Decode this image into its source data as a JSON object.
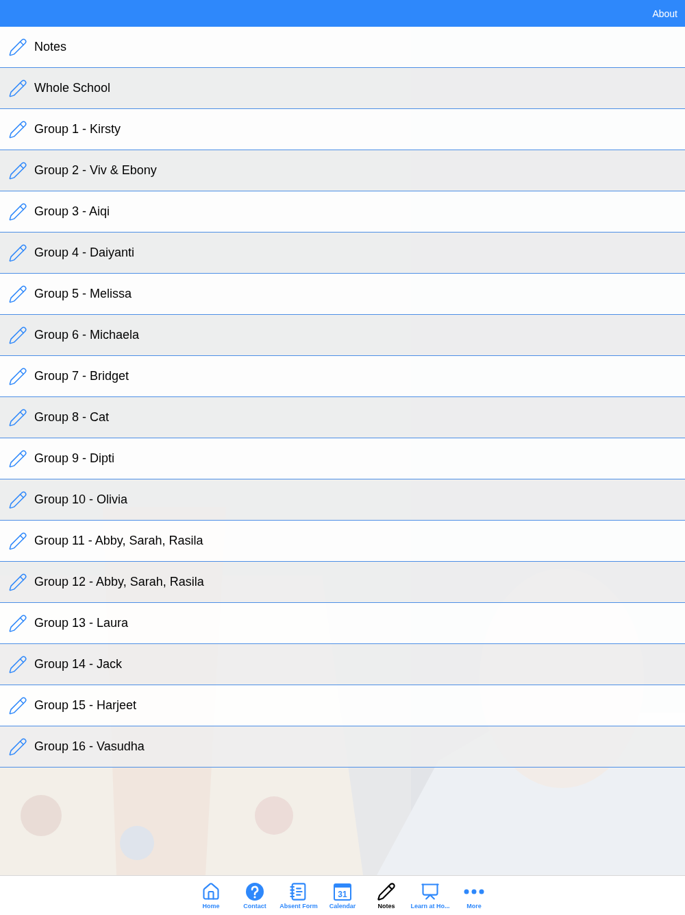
{
  "header": {
    "action": "About"
  },
  "list": [
    {
      "label": "Notes"
    },
    {
      "label": "Whole School"
    },
    {
      "label": "Group 1 - Kirsty"
    },
    {
      "label": "Group 2 - Viv & Ebony"
    },
    {
      "label": "Group 3 - Aiqi"
    },
    {
      "label": "Group 4 - Daiyanti"
    },
    {
      "label": "Group 5 - Melissa"
    },
    {
      "label": "Group 6 - Michaela"
    },
    {
      "label": "Group 7 - Bridget"
    },
    {
      "label": "Group 8 - Cat"
    },
    {
      "label": "Group 9 - Dipti"
    },
    {
      "label": "Group 10 - Olivia"
    },
    {
      "label": "Group 11 - Abby, Sarah, Rasila"
    },
    {
      "label": "Group 12 - Abby, Sarah, Rasila"
    },
    {
      "label": "Group 13 - Laura"
    },
    {
      "label": "Group 14 - Jack"
    },
    {
      "label": "Group 15 - Harjeet"
    },
    {
      "label": "Group 16 - Vasudha"
    }
  ],
  "tab_bar": [
    {
      "kind": "home",
      "label": "Home",
      "selected": false
    },
    {
      "kind": "help",
      "label": "Contact",
      "selected": false
    },
    {
      "kind": "form",
      "label": "Absent Form",
      "selected": false
    },
    {
      "kind": "calendar",
      "label": "Calendar",
      "icon_text": "31",
      "selected": false
    },
    {
      "kind": "notes",
      "label": "Notes",
      "selected": true
    },
    {
      "kind": "screen",
      "label": "Learn at Ho...",
      "selected": false
    },
    {
      "kind": "more",
      "label": "More",
      "selected": false
    }
  ]
}
